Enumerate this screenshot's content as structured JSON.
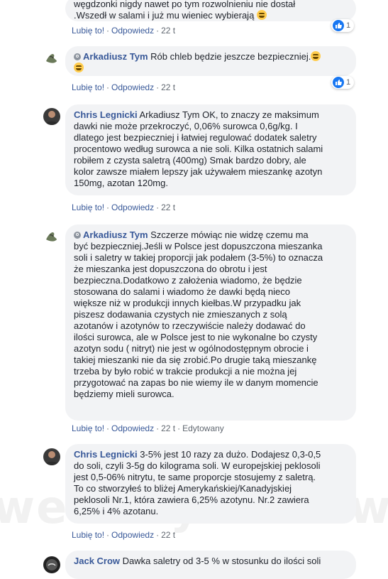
{
  "comments": [
    {
      "id": "c0",
      "text_lines": [
        "węgdzonki nigdy nawet po tym rozwolnieniu nie dostał",
        ".Wszedł w salami i już mu wieniec wybierają"
      ],
      "actions": {
        "like": "Lubię to!",
        "reply": "Odpowiedz",
        "time": "22 t"
      },
      "reactions": "1"
    },
    {
      "id": "c1",
      "author": "Arkadiusz Tym",
      "text": "Rób chleb będzie jeszcze bezpieczniej.",
      "actions": {
        "like": "Lubię to!",
        "reply": "Odpowiedz",
        "time": "22 t"
      },
      "reactions": "1"
    },
    {
      "id": "c2",
      "author": "Chris Legnicki",
      "text_lines": [
        "Arkadiusz Tym OK, to znaczy ze maksimum",
        "dawki nie może przekroczyć, 0,06% surowca 0,6g/kg. I",
        "dlatego jest bezpieczniej i łatwiej regulować dodatek saletry",
        "procentowo według surowca a nie soli. Kilka ostatnich salami",
        "robiłem z czysta saletrą (400mg) Smak bardzo dobry, ale",
        "kolor zawsze miałem lepszy jak używałem mieszankę azotyn",
        "150mg, azotan 120mg."
      ],
      "actions": {
        "like": "Lubię to!",
        "reply": "Odpowiedz",
        "time": "22 t"
      }
    },
    {
      "id": "c3",
      "author": "Arkadiusz Tym",
      "text_lines": [
        "Szczerze mówiąc nie widzę czemu ma",
        "być bezpieczniej.Jeśli w Polsce jest dopuszczona mieszanka",
        "soli i saletry w takiej proporcji jak podałem (3-5%) to oznacza",
        "że mieszanka jest dopuszczona do obrotu i jest",
        "bezpieczna.Dodatkowo z założenia wiadomo, że będzie",
        "stosowana do salami i wiadomo że dawki będą nieco",
        "większe niż w produkcji innych kiełbas.W przypadku jak",
        "piszesz dodawania czystych nie zmieszanych z solą",
        "azotanów i azotynów to rzeczywiście należy dodawać do",
        "ilości surowca, ale w Polsce jest to nie wykonalne bo czysty",
        "azotyn sodu ( nitryt) nie jest w ogólnodostępnym obrocie i",
        "takiej mieszanki nie da się zrobić.Po drugie taką mieszankę",
        "trzeba by było robić w trakcie produkcji a nie można jej",
        "przygotować na zapas bo nie wiemy ile w danym momencie",
        "będziemy mieli surowca."
      ],
      "actions": {
        "like": "Lubię to!",
        "reply": "Odpowiedz",
        "time": "22 t",
        "edited": "Edytowany"
      }
    },
    {
      "id": "c4",
      "author": "Chris Legnicki",
      "text_lines": [
        "3-5% jest 10 razy za dużo. Dodajesz 0,3-0,5",
        "do soli, czyli 3-5g do kilograma soli. W europejskiej peklosoli",
        "jest 0,5-06% nitrytu, te same proporcje stosujemy z saletrą.",
        "To co stworzyłeś to bliżej Amerykańskiej/Kanadyjskiej",
        "peklosoli Nr.1, która zawiera 6,25% azotynu. Nr.2 zawiera",
        "6,25% i 4% azotanu."
      ],
      "actions": {
        "like": "Lubię to!",
        "reply": "Odpowiedz",
        "time": "22 t"
      }
    },
    {
      "id": "c5",
      "author": "Jack Crow",
      "text": "Dawka saletry od 3-5 % w stosunku do ilości soli"
    }
  ],
  "watermark": "wedlinydomowe.pl",
  "colors": {
    "link": "#385898",
    "bubble": "#f2f3f5",
    "meta": "#606770",
    "like": "#1877f2"
  }
}
